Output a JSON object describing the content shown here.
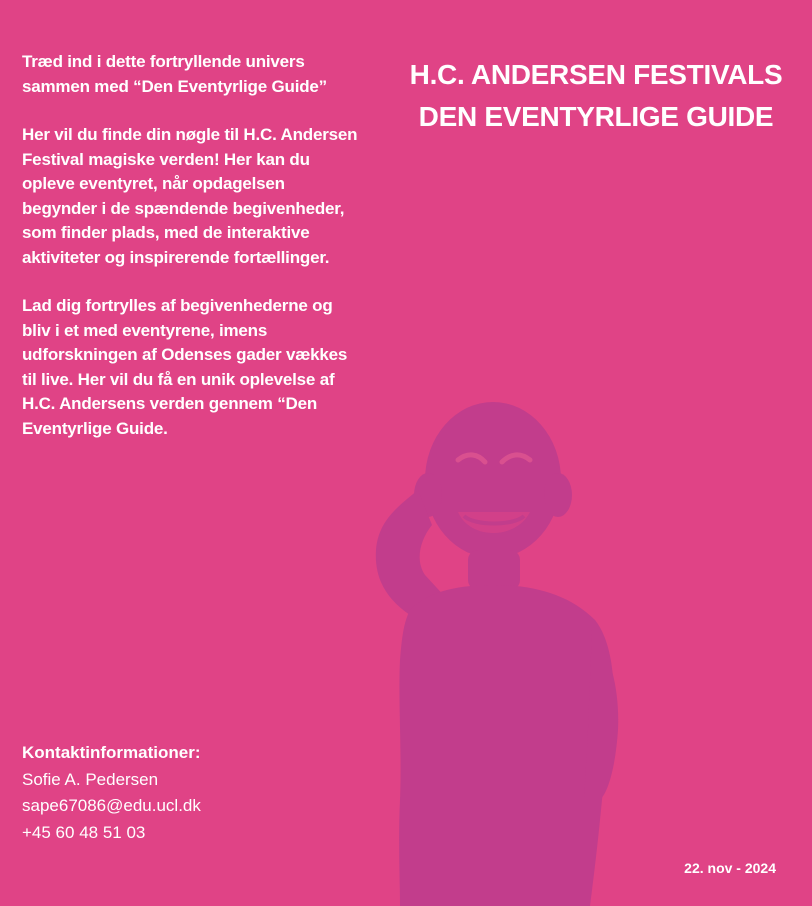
{
  "colors": {
    "background": "#e04386",
    "silhouette": "#c23d8c",
    "text": "#ffffff"
  },
  "intro": {
    "paragraphs": [
      "Træd ind i dette fortryllende univers sammen med “Den Eventyrlige Guide”",
      "Her vil du finde din nøgle til H.C. Andersen Festival magiske verden! Her kan du opleve eventyret, når opdagelsen begynder i de spændende begivenheder, som finder plads, med de interaktive aktiviteter og inspirerende fortællinger.",
      "Lad dig fortrylles af begivenhederne og bliv i et med eventyrene, imens udforskningen af Odenses gader vækkes til live. Her vil du få en unik oplevelse af H.C. Andersens verden gennem “Den Eventyrlige Guide."
    ]
  },
  "title": {
    "line1": "H.C. ANDERSEN FESTIVALS",
    "line2": "DEN EVENTYRLIGE GUIDE"
  },
  "image": {
    "icon": "laughing-child-silhouette"
  },
  "contact": {
    "heading": "Kontaktinformationer:",
    "name": "Sofie A. Pedersen",
    "email": "sape67086@edu.ucl.dk",
    "phone": "+45 60 48 51 03"
  },
  "date": "22. nov - 2024"
}
